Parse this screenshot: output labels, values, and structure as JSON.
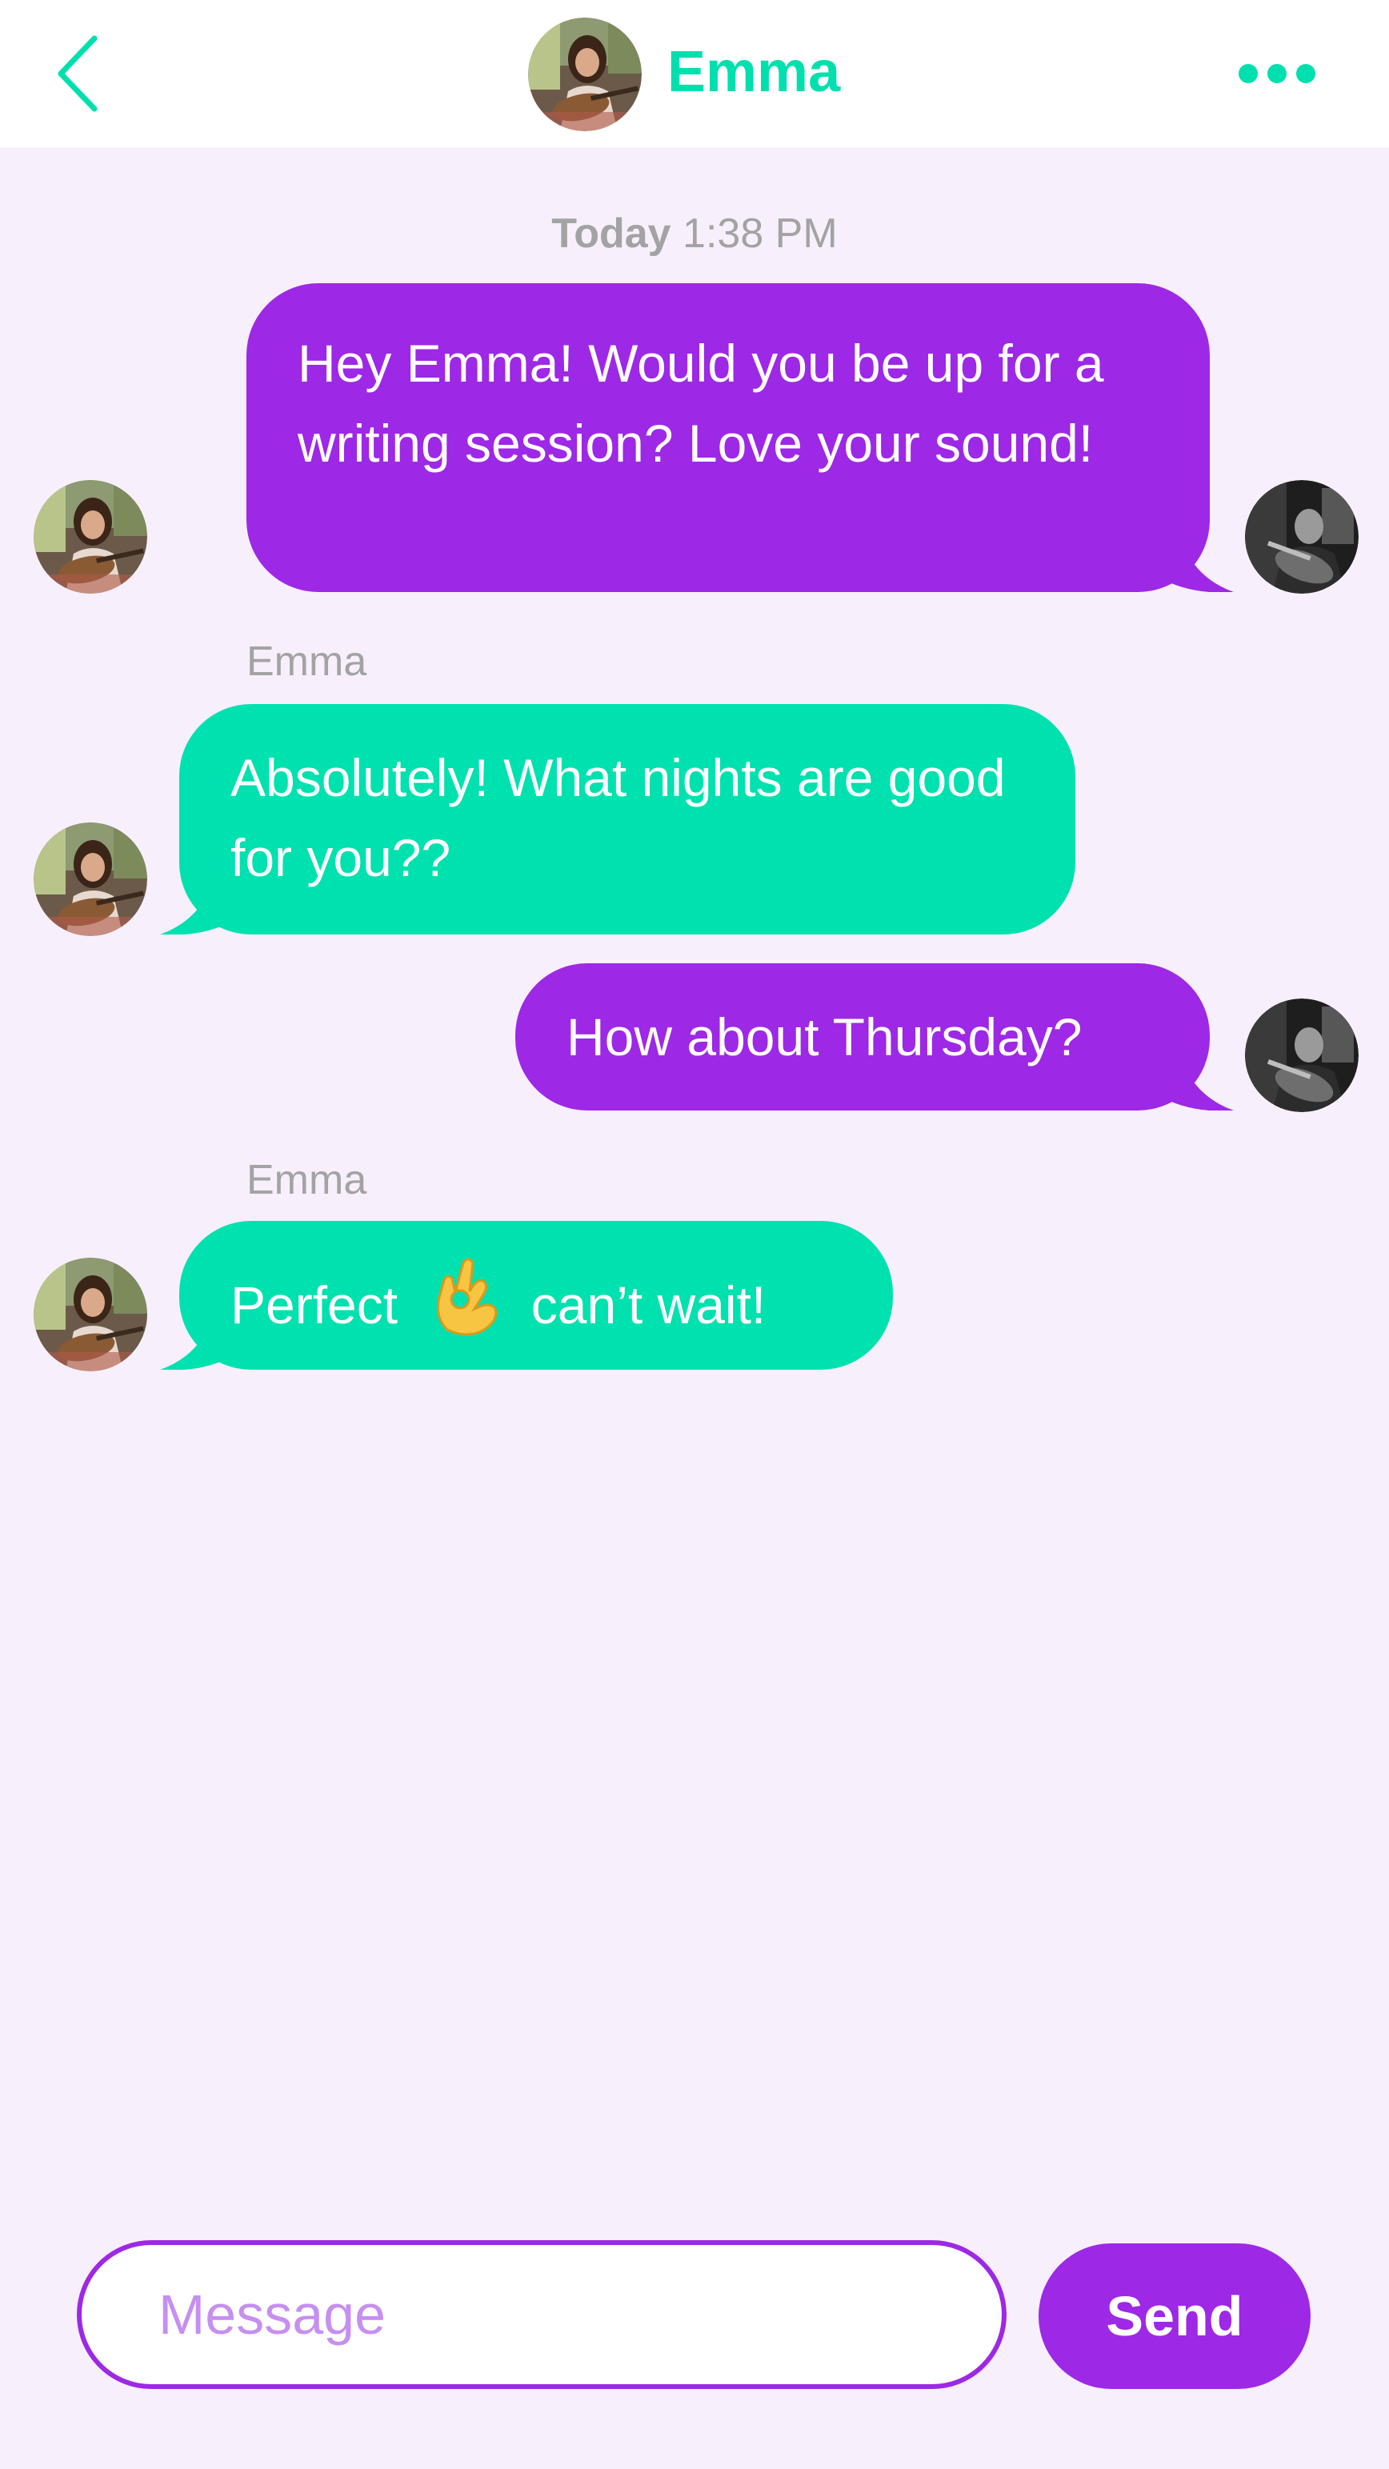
{
  "header": {
    "contact_name": "Emma",
    "back_icon": "chevron-left-icon",
    "more_icon": "ellipsis-icon"
  },
  "timestamp": {
    "day": "Today",
    "time": "1:38 PM"
  },
  "messages": [
    {
      "direction": "outgoing",
      "text": "Hey Emma! Would you be up for a writing session? Love your sound!"
    },
    {
      "direction": "incoming",
      "sender": "Emma",
      "text": "Absolutely! What nights are good for you??"
    },
    {
      "direction": "outgoing",
      "text": "How about Thursday?"
    },
    {
      "direction": "incoming",
      "sender": "Emma",
      "text_before": "Perfect",
      "emoji": "ok-hand-icon",
      "text_after": "can’t wait!"
    }
  ],
  "composer": {
    "placeholder": "Message",
    "send_label": "Send"
  },
  "colors": {
    "accent_purple": "#9d28e5",
    "accent_teal": "#00e1b0",
    "background": "#f8effc",
    "muted_text": "#a3a3a3"
  }
}
